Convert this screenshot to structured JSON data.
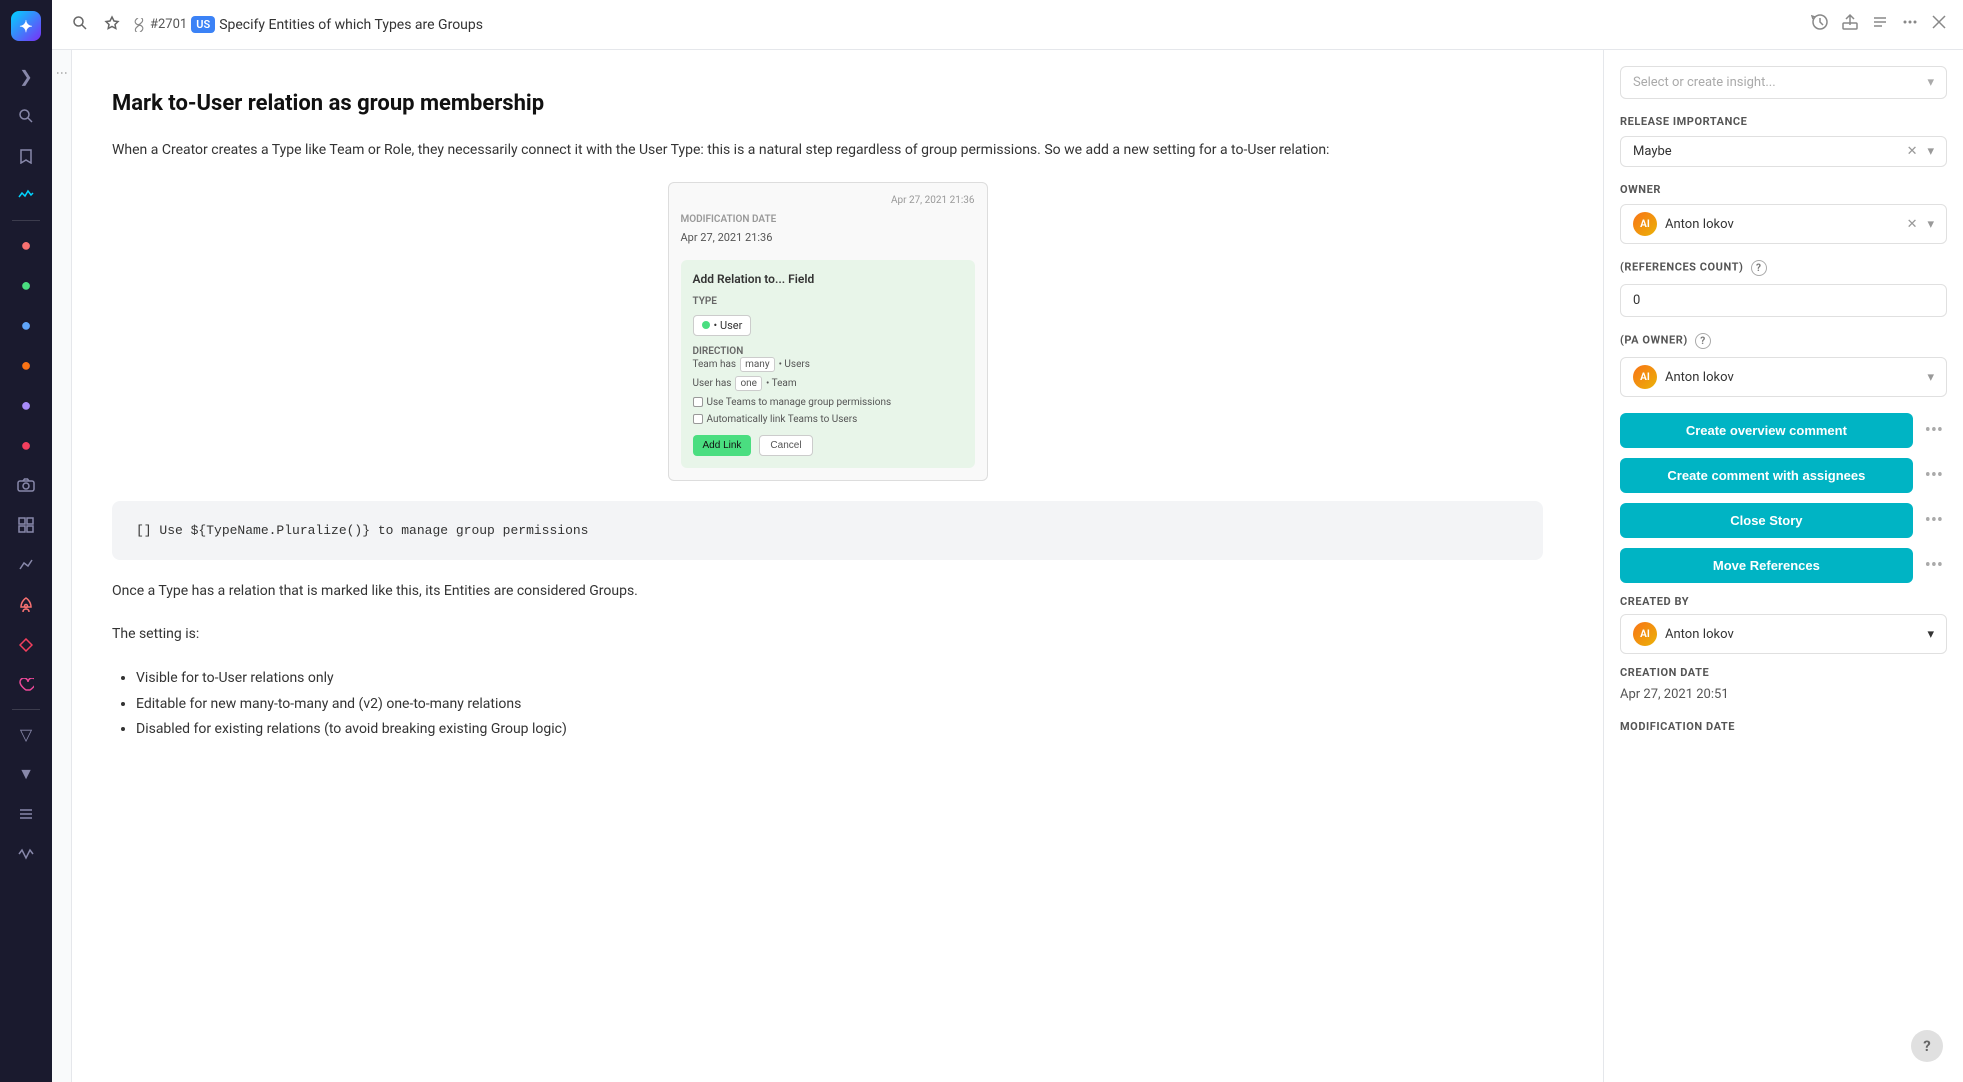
{
  "sidebar": {
    "logo": "✦",
    "items": [
      {
        "name": "collapse-toggle",
        "icon": "❯",
        "label": "Collapse"
      },
      {
        "name": "search",
        "icon": "🔍",
        "label": "Search"
      },
      {
        "name": "bookmark",
        "icon": "☆",
        "label": "Bookmark"
      },
      {
        "name": "nav-home",
        "icon": "⚡",
        "label": "Activity"
      },
      {
        "name": "nav-circle1",
        "icon": "●",
        "label": "Item 1",
        "color": "#f87171"
      },
      {
        "name": "nav-circle2",
        "icon": "●",
        "label": "Item 2",
        "color": "#4ade80"
      },
      {
        "name": "nav-circle3",
        "icon": "●",
        "label": "Item 3",
        "color": "#60a5fa"
      },
      {
        "name": "nav-circle4",
        "icon": "●",
        "label": "Item 4",
        "color": "#f97316"
      },
      {
        "name": "nav-circle5",
        "icon": "●",
        "label": "Item 5",
        "color": "#a78bfa"
      },
      {
        "name": "nav-circle6",
        "icon": "●",
        "label": "Item 6",
        "color": "#f43f5e"
      },
      {
        "name": "nav-camera",
        "icon": "◎",
        "label": "Camera"
      },
      {
        "name": "nav-grid",
        "icon": "⊞",
        "label": "Grid"
      },
      {
        "name": "nav-chart",
        "icon": "📊",
        "label": "Chart"
      },
      {
        "name": "nav-rocket",
        "icon": "🚀",
        "label": "Rocket"
      },
      {
        "name": "nav-diamond",
        "icon": "◇",
        "label": "Diamond"
      },
      {
        "name": "nav-heart",
        "icon": "♡",
        "label": "Heart"
      },
      {
        "name": "nav-pin",
        "icon": "▽",
        "label": "Pin"
      },
      {
        "name": "nav-arrow-down",
        "icon": "▼",
        "label": "Arrow Down"
      },
      {
        "name": "nav-list",
        "icon": "≡",
        "label": "List"
      },
      {
        "name": "nav-wave",
        "icon": "∿",
        "label": "Wave"
      }
    ]
  },
  "topbar": {
    "search_icon": "🔍",
    "bookmark_icon": "☆",
    "story_number": "#2701",
    "us_badge": "US",
    "story_title": "Specify Entities of which Types are Groups",
    "history_icon": "🕐",
    "share_icon": "⬆",
    "menu_icon": "≡",
    "more_icon": "…",
    "close_icon": "✕"
  },
  "story": {
    "heading": "Mark to-User relation as group membership",
    "paragraph1": "When a Creator creates a Type like Team or Role, they necessarily connect it with the User Type: this is a natural step regardless of group permissions. So we add a new setting for a to-User relation:",
    "image": {
      "date_label": "Apr 27, 2021 21:36",
      "modification_date_label": "MODIFICATION DATE",
      "modification_date_value": "Apr 27, 2021 21:36",
      "add_relation_title": "Add Relation to... Field",
      "type_label": "TYPE",
      "type_value": "• User",
      "direction_label": "DIRECTION",
      "direction_row1_left": "Team has",
      "direction_row1_mid": "many",
      "direction_row1_right": "• Users",
      "direction_row2_left": "User has",
      "direction_row2_mid": "one",
      "direction_row2_right": "• Team",
      "checkbox1": "Use Teams to manage group permissions",
      "checkbox2": "Automatically link Teams to Users",
      "btn_add": "Add Link",
      "btn_cancel": "Cancel"
    },
    "code_block": "[] Use ${TypeName.Pluralize()} to manage group permissions",
    "paragraph2": "Once a Type has a relation that is marked like this, its Entities are considered Groups.",
    "paragraph3": "The setting is:",
    "bullet_items": [
      "Visible for to-User relations only",
      "Editable for new many-to-many and (v2) one-to-many relations",
      "Disabled for existing relations (to avoid breaking existing Group logic)"
    ]
  },
  "right_panel": {
    "insight_placeholder": "Select or create insight...",
    "release_importance_label": "RELEASE IMPORTANCE",
    "release_importance_value": "Maybe",
    "owner_label": "OWNER",
    "owner_name": "Anton Iokov",
    "references_count_label": "(REFERENCES COUNT)",
    "references_count_value": "0",
    "pa_owner_label": "(PA OWNER)",
    "pa_owner_name": "Anton Iokov",
    "create_overview_comment_label": "Create overview comment",
    "create_comment_assignees_label": "Create comment with assignees",
    "close_story_label": "Close Story",
    "move_references_label": "Move References",
    "created_by_label": "CREATED BY",
    "created_by_name": "Anton Iokov",
    "creation_date_label": "CREATION DATE",
    "creation_date_value": "Apr 27, 2021 20:51",
    "modification_date_label": "MODIFICATION DATE"
  }
}
